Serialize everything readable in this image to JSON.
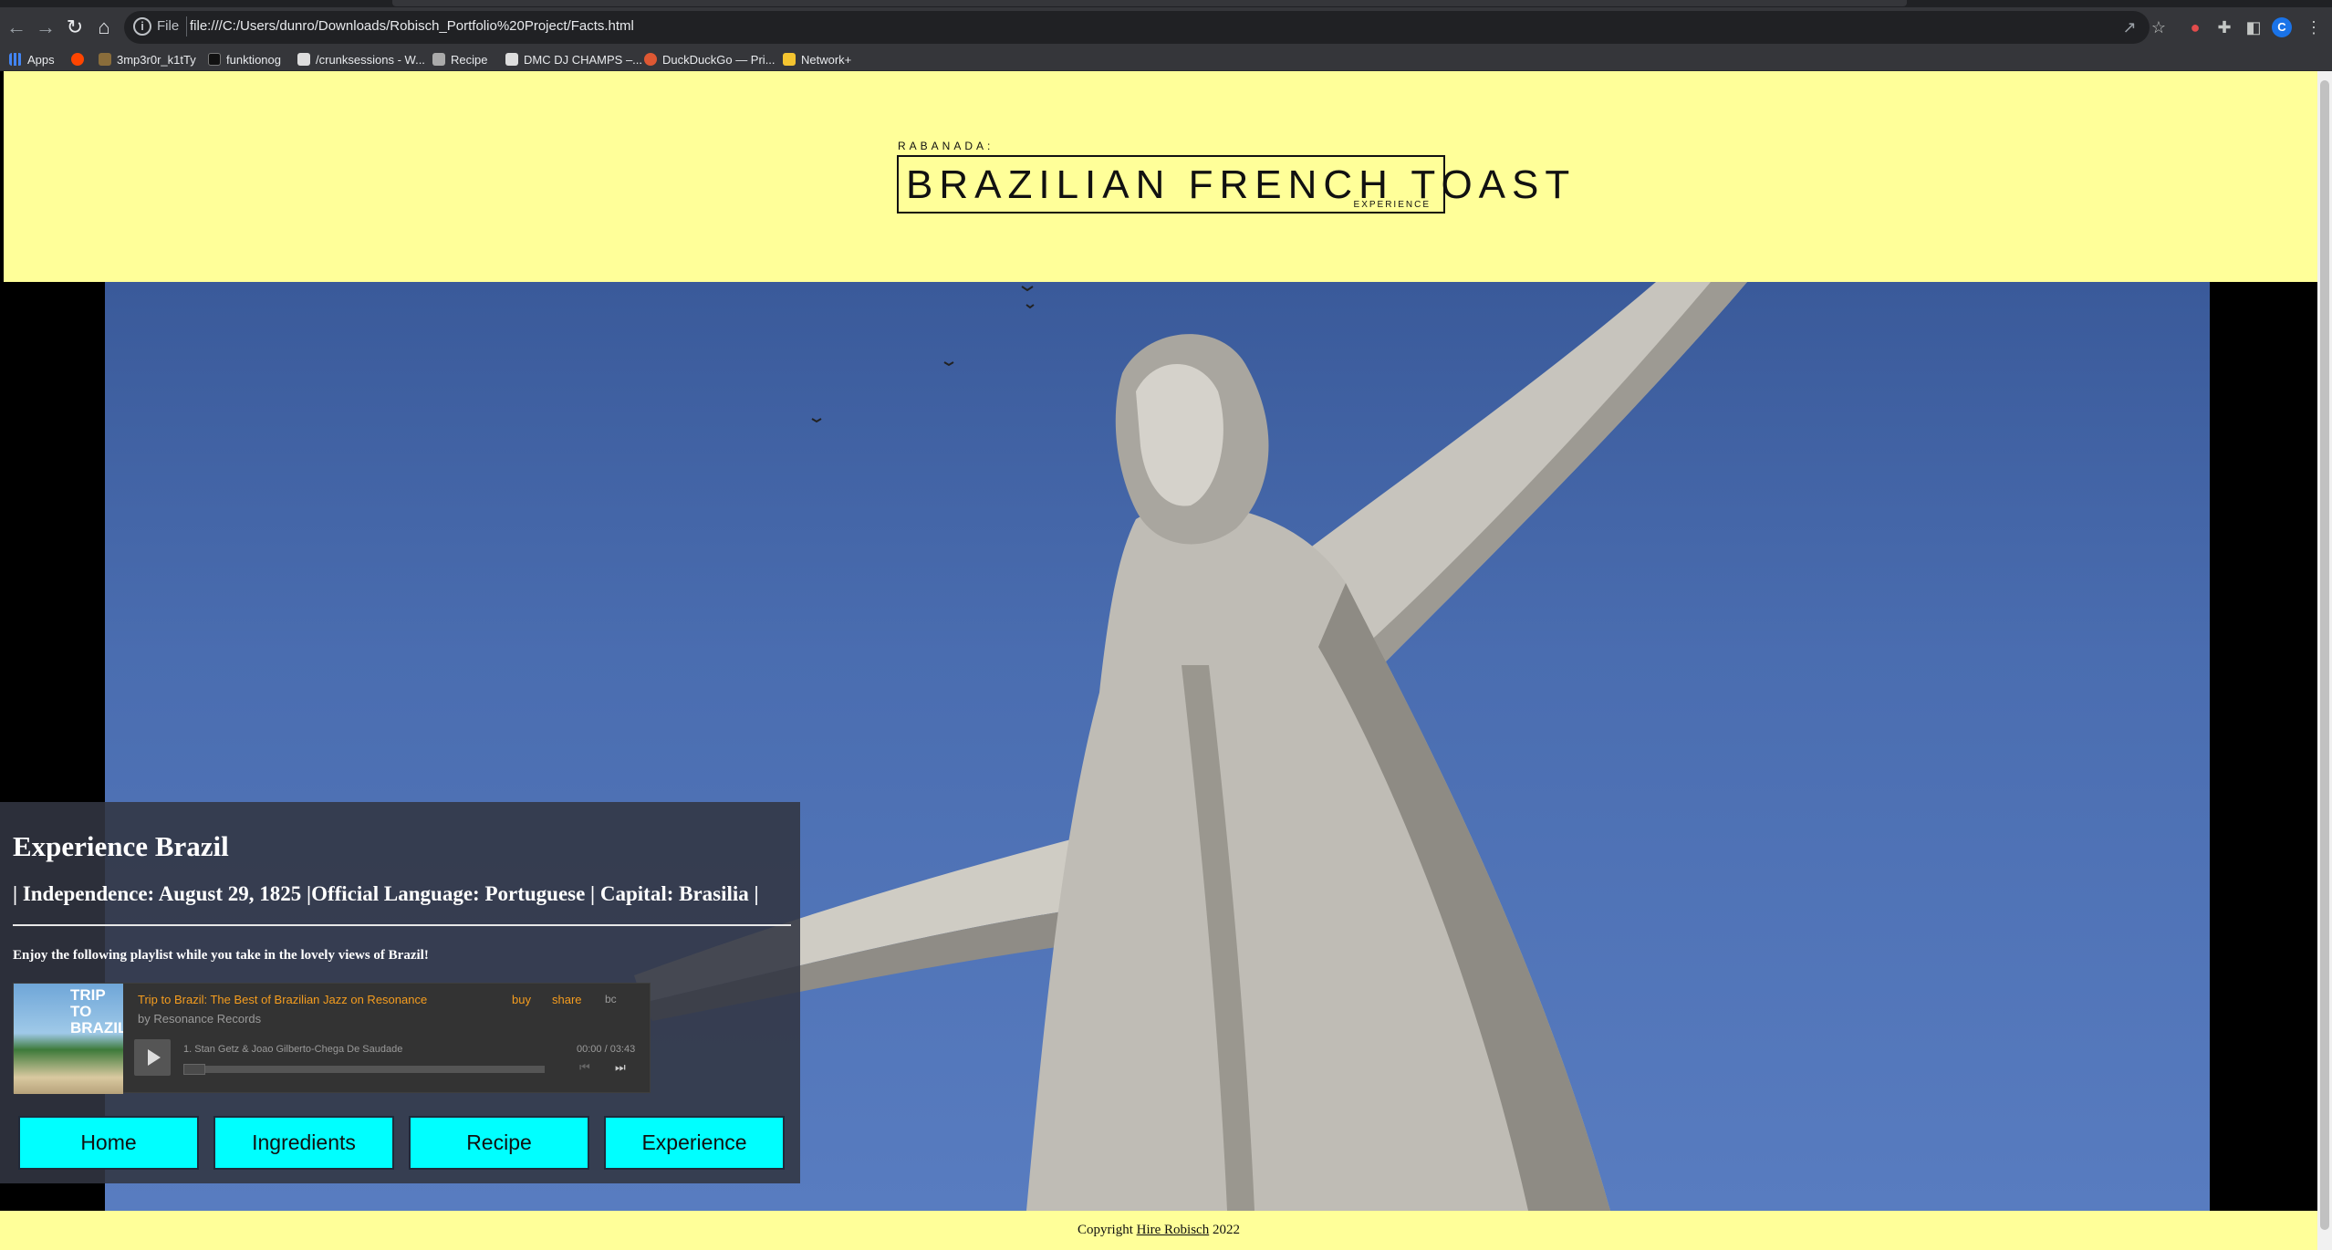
{
  "browser": {
    "address": {
      "scheme_label": "File",
      "url": "file:///C:/Users/dunro/Downloads/Robisch_Portfolio%20Project/Facts.html"
    },
    "bookmarks": [
      {
        "label": "Apps",
        "color": "#4285f4"
      },
      {
        "label": "",
        "color": "#ff4500"
      },
      {
        "label": "3mp3r0r_k1tTy",
        "color": "#8a6d3b"
      },
      {
        "label": "funktionog",
        "color": "#222222"
      },
      {
        "label": "/crunksessions - W...",
        "color": "#dddddd"
      },
      {
        "label": "Recipe",
        "color": "#aaaaaa"
      },
      {
        "label": "DMC DJ CHAMPS –...",
        "color": "#dddddd"
      },
      {
        "label": "DuckDuckGo — Pri...",
        "color": "#de5833"
      },
      {
        "label": "Network+",
        "color": "#f4c430"
      }
    ],
    "profile_initial": "C"
  },
  "site": {
    "logo": {
      "small": "RABANADA:",
      "title": "BRAZILIAN FRENCH TOAST",
      "sub": "EXPERIENCE"
    },
    "overlay": {
      "title": "Experience Brazil",
      "facts": "| Independence: August 29, 1825 |Official Language: Portuguese | Capital: Brasilia |",
      "note": "Enjoy the following playlist while you take in the lovely views of Brazil!"
    },
    "player": {
      "cover_text": "TRIP TO BRAZIL",
      "album_title": "Trip to Brazil: The Best of Brazilian Jazz on Resonance",
      "by": "by Resonance Records",
      "buy": "buy",
      "share": "share",
      "brand": "bc",
      "track": "1.  Stan Getz & Joao Gilberto-Chega De Saudade",
      "time": "00:00 / 03:43",
      "progress": 0
    },
    "nav": [
      "Home",
      "Ingredients",
      "Recipe",
      "Experience"
    ],
    "footer": {
      "prefix": "Copyright ",
      "link": "Hire Robisch",
      "suffix": " 2022"
    }
  },
  "colors": {
    "banner": "#ffff99",
    "nav_button": "#00ffff",
    "accent_link": "#f59d1f"
  }
}
